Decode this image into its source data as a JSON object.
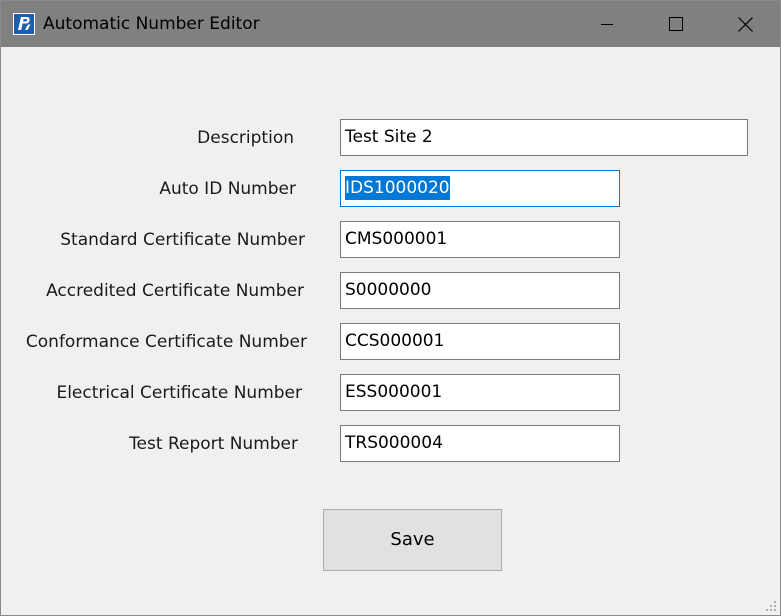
{
  "window": {
    "title": "Automatic Number Editor"
  },
  "title_buttons": {
    "minimize": "minimize-icon",
    "maximize": "maximize-icon",
    "close": "close-icon"
  },
  "form": {
    "description": {
      "label": "Description",
      "value": "Test Site 2"
    },
    "auto_id": {
      "label": "Auto ID Number",
      "value": "IDS1000020"
    },
    "standard_cert": {
      "label": "Standard Certificate Number",
      "value": "CMS000001"
    },
    "accredited_cert": {
      "label": "Accredited Certificate Number",
      "value": "S0000000"
    },
    "conformance_cert": {
      "label": "Conformance Certificate Number",
      "value": "CCS000001"
    },
    "electrical_cert": {
      "label": "Electrical Certificate Number",
      "value": "ESS000001"
    },
    "test_report": {
      "label": "Test Report Number",
      "value": "TRS000004"
    }
  },
  "actions": {
    "save_label": "Save"
  },
  "colors": {
    "titlebar": "#808080",
    "window_bg": "#f0f0f0",
    "focus_accent": "#0078d7",
    "button_bg": "#e1e1e1"
  }
}
